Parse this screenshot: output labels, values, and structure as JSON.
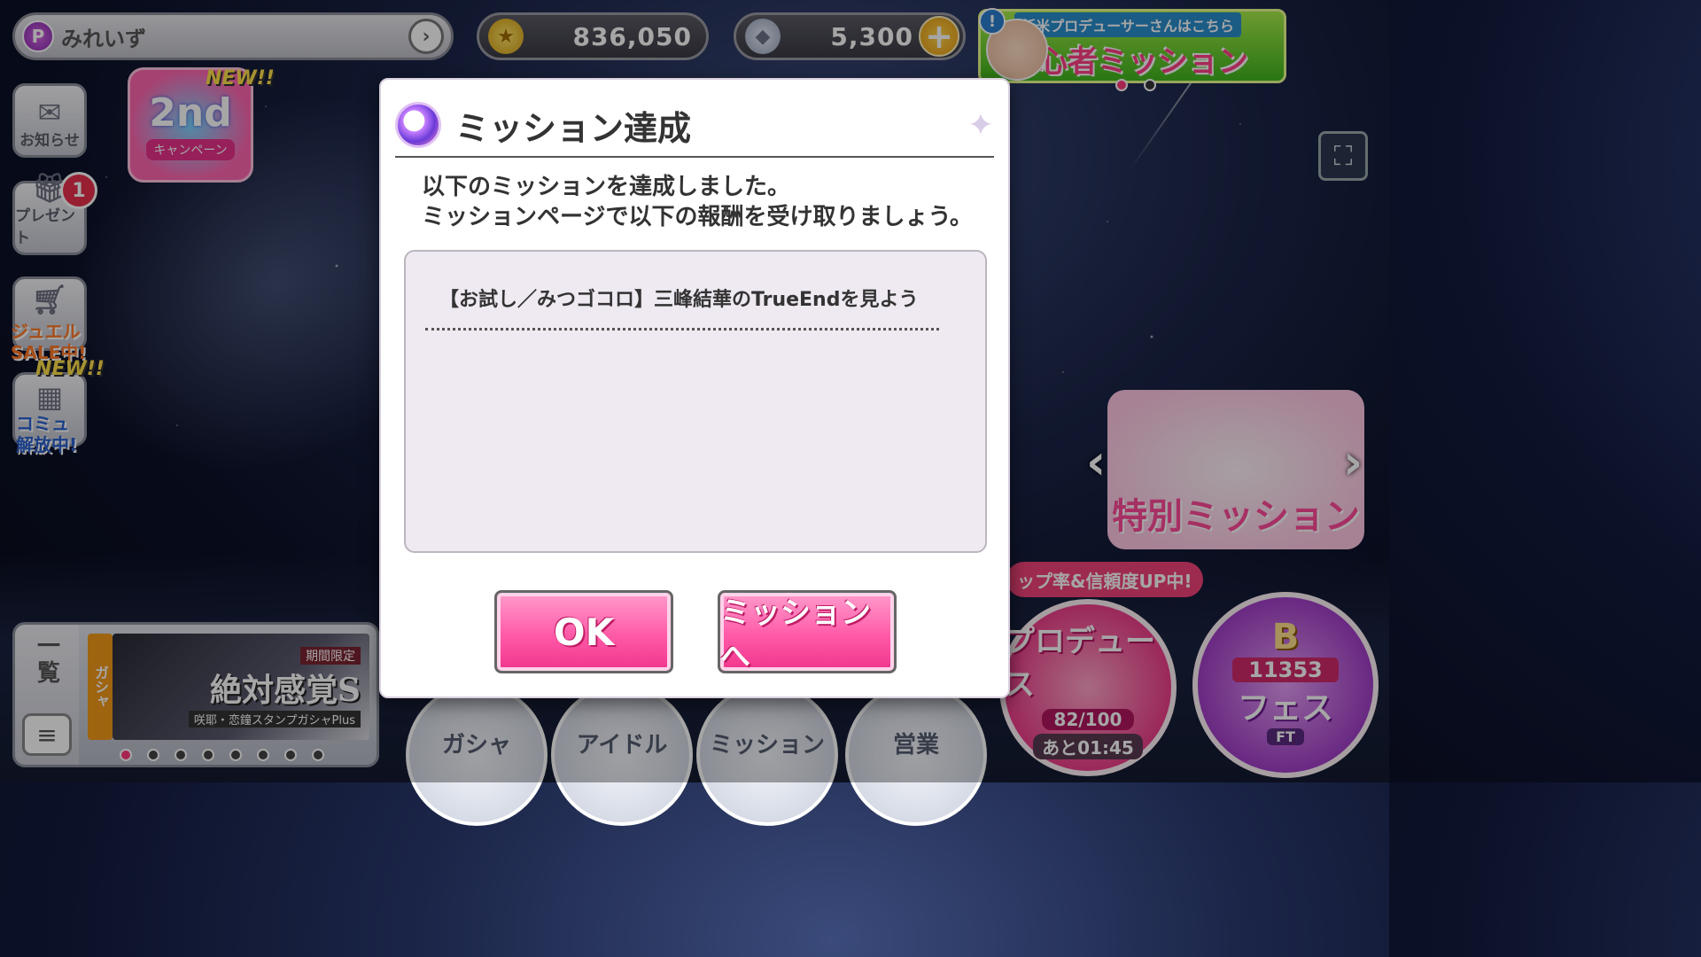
{
  "header": {
    "player_badge": "P",
    "player_name": "みれいず",
    "coins": "836,050",
    "jewels": "5,300",
    "beginner_banner": {
      "title_small": "新米プロデューサーさんはこちら",
      "title_main": "初心者ミッション",
      "alert": "!"
    }
  },
  "sidebar": {
    "news_label": "お知らせ",
    "present_label": "プレゼント",
    "present_badge": "1",
    "jewel_sale": "ジュエル\nSALE中!",
    "commu_label": "コミュ\n解放中!",
    "new_tag": "NEW!!"
  },
  "anniversary_campaign": {
    "new_tag": "NEW!!",
    "title": "2nd",
    "subtitle": "キャンペーン"
  },
  "event_banner": {
    "title": "特別ミッション"
  },
  "bonus_strip": "ップ率&信頼度UP中!",
  "produce": {
    "label": "プロデュース",
    "count": "82/100",
    "remaining": "あと01:45"
  },
  "fes": {
    "rank": "B",
    "score": "11353",
    "label": "フェス",
    "ft": "FT"
  },
  "gacha_panel": {
    "list_label": "一覧",
    "tag": "ガシャ",
    "limited": "期間限定",
    "title": "絶対感覚S",
    "subtitle": "咲耶・恋鐘スタンプガシャPlus"
  },
  "nav": {
    "gacha": "ガシャ",
    "idol": "アイドル",
    "mission": "ミッション",
    "business": "営業"
  },
  "modal": {
    "title": "ミッション達成",
    "message": "以下のミッションを達成しました。\nミッションページで以下の報酬を受け取りましょう。",
    "item": "【お試し／みつゴコロ】三峰結華のTrueEndを見よう",
    "ok_label": "OK",
    "mission_label": "ミッションへ"
  },
  "colors": {
    "accent_pink": "#ff5aa8",
    "fes_purple": "#a23fc8",
    "beginner_green": "#3fb61e"
  }
}
